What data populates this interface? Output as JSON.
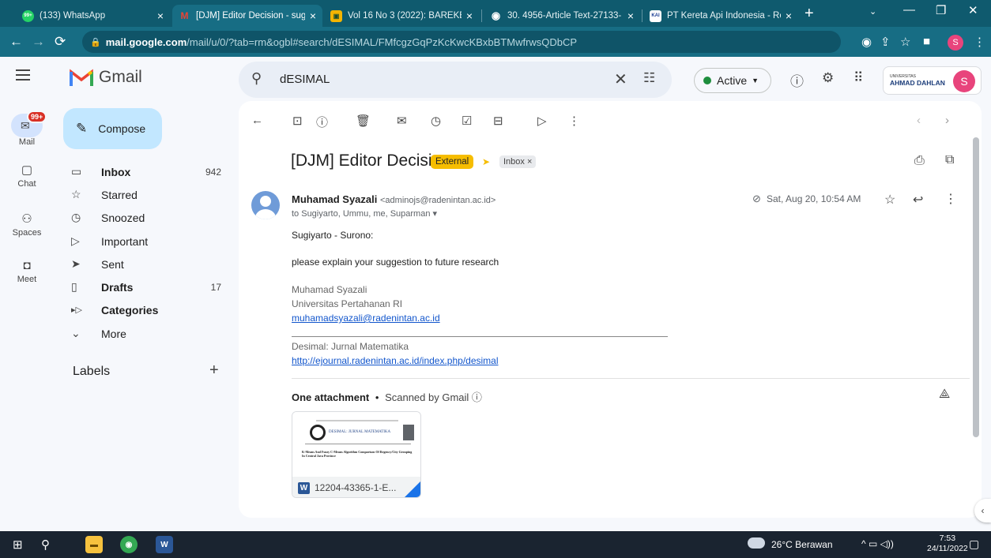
{
  "browser": {
    "tabs": [
      {
        "title": "(133) WhatsApp",
        "fav": "99+"
      },
      {
        "title": "[DJM] Editor Decision - sugiy",
        "fav": "M"
      },
      {
        "title": "Vol 16 No 3 (2022): BAREKEN",
        "fav": "▣"
      },
      {
        "title": "30. 4956-Article Text-27133-",
        "fav": "◉"
      },
      {
        "title": "PT Kereta Api Indonesia - Re",
        "fav": "KAI"
      }
    ],
    "new_tab": "+",
    "url_host": "mail.google.com",
    "url_rest": "/mail/u/0/?tab=rm&ogbl#search/dESIMAL/FMfcgzGqPzKcKwcKBxbBTMwfrwsQDbCP",
    "profile_initial": "S"
  },
  "gmail": {
    "brand": "Gmail",
    "search_value": "dESIMAL",
    "status": "Active",
    "org": {
      "line1": "UNIVERSITAS",
      "line2": "AHMAD DAHLAN"
    },
    "avatar_initial": "S"
  },
  "rail": {
    "badge": "99+",
    "items": [
      {
        "label": "Mail"
      },
      {
        "label": "Chat"
      },
      {
        "label": "Spaces"
      },
      {
        "label": "Meet"
      }
    ]
  },
  "nav": {
    "compose": "Compose",
    "items": [
      {
        "label": "Inbox",
        "count": "942",
        "icon": "▭"
      },
      {
        "label": "Starred",
        "count": "",
        "icon": "☆"
      },
      {
        "label": "Snoozed",
        "count": "",
        "icon": "◷"
      },
      {
        "label": "Important",
        "count": "",
        "icon": "▷"
      },
      {
        "label": "Sent",
        "count": "",
        "icon": "➤"
      },
      {
        "label": "Drafts",
        "count": "17",
        "icon": "▯"
      },
      {
        "label": "Categories",
        "count": "",
        "icon": "▸▷"
      },
      {
        "label": "More",
        "count": "",
        "icon": "⌄"
      }
    ],
    "labels_header": "Labels"
  },
  "email": {
    "subject": "[DJM] Editor Decision",
    "tag_external": "External",
    "tag_inbox": "Inbox ×",
    "sender_name": "Muhamad Syazali",
    "sender_email": "<adminojs@radenintan.ac.id>",
    "recipients": "to Sugiyarto, Ummu, me, Suparman ▾",
    "date": "Sat, Aug 20, 10:54 AM",
    "greeting": "Sugiyarto - Surono:",
    "body": "please explain your suggestion to future research",
    "sig_name": "Muhamad Syazali",
    "sig_org": "Universitas Pertahanan RI",
    "sig_email": "muhamadsyazali@radenintan.ac.id",
    "journal": "Desimal: Jurnal Matematika",
    "journal_url": "http://ejournal.radenintan.ac.id/index.php/desimal",
    "attach_count": "One attachment",
    "scanned": "Scanned by Gmail ⓘ",
    "attach_name": "12204-43365-1-E...",
    "attach_preview_title": "DESIMAL: JURNAL MATEMATIKA",
    "attach_preview_paper": "K-Means And Fuzzy C-Means Algorithm Comparison Of Regency/City Grouping In Central Java Province"
  },
  "taskbar": {
    "weather": "26°C  Berawan",
    "time": "7:53",
    "date": "24/11/2022"
  }
}
